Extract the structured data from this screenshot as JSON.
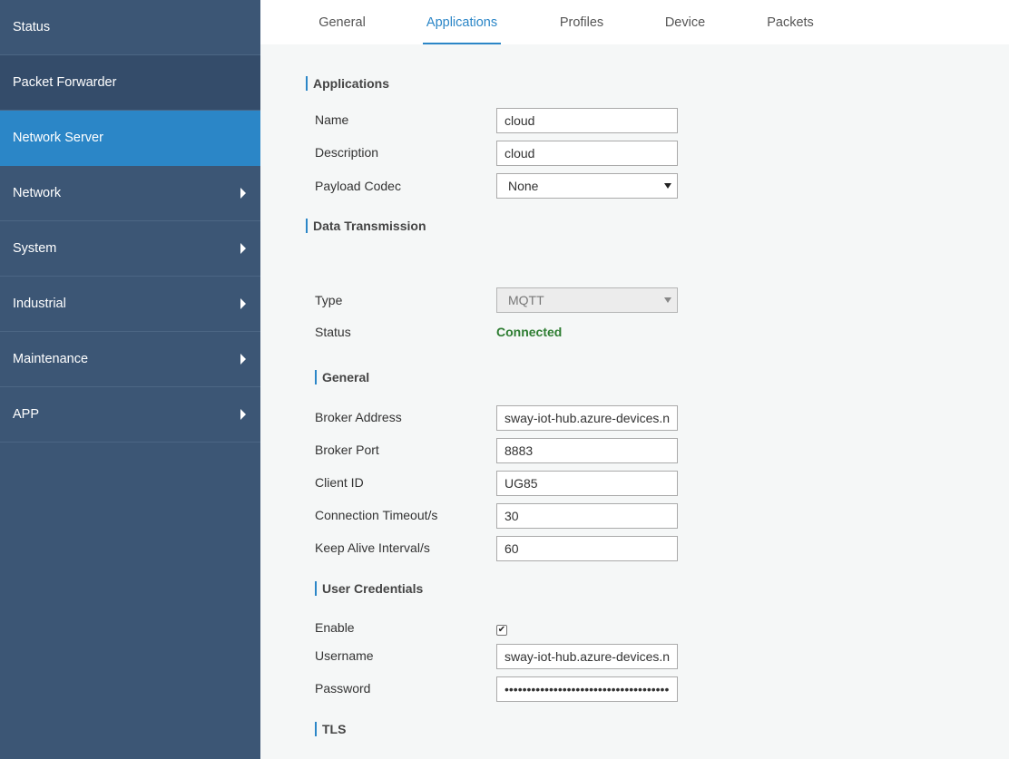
{
  "sidebar": {
    "items": [
      {
        "label": "Status"
      },
      {
        "label": "Packet Forwarder"
      },
      {
        "label": "Network Server"
      },
      {
        "label": "Network"
      },
      {
        "label": "System"
      },
      {
        "label": "Industrial"
      },
      {
        "label": "Maintenance"
      },
      {
        "label": "APP"
      }
    ]
  },
  "tabs": [
    {
      "label": "General"
    },
    {
      "label": "Applications"
    },
    {
      "label": "Profiles"
    },
    {
      "label": "Device"
    },
    {
      "label": "Packets"
    }
  ],
  "applications": {
    "title": "Applications",
    "name_label": "Name",
    "name_value": "cloud",
    "description_label": "Description",
    "description_value": "cloud",
    "codec_label": "Payload Codec",
    "codec_value": "None"
  },
  "data_transmission": {
    "title": "Data Transmission",
    "type_label": "Type",
    "type_value": "MQTT",
    "status_label": "Status",
    "status_value": "Connected"
  },
  "general": {
    "title": "General",
    "broker_address_label": "Broker Address",
    "broker_address_value": "sway-iot-hub.azure-devices.net",
    "broker_port_label": "Broker Port",
    "broker_port_value": "8883",
    "client_id_label": "Client ID",
    "client_id_value": "UG85",
    "timeout_label": "Connection Timeout/s",
    "timeout_value": "30",
    "keepalive_label": "Keep Alive Interval/s",
    "keepalive_value": "60"
  },
  "credentials": {
    "title": "User Credentials",
    "enable_label": "Enable",
    "enable_checked": "✔",
    "username_label": "Username",
    "username_value": "sway-iot-hub.azure-devices.net/",
    "password_label": "Password",
    "password_value": "••••••••••••••••••••••••••••••••••••••••"
  },
  "tls": {
    "title": "TLS"
  },
  "colors": {
    "sidebar_bg": "#3c5675",
    "active_bg": "#2b86c7",
    "connected": "#2e7d32"
  }
}
